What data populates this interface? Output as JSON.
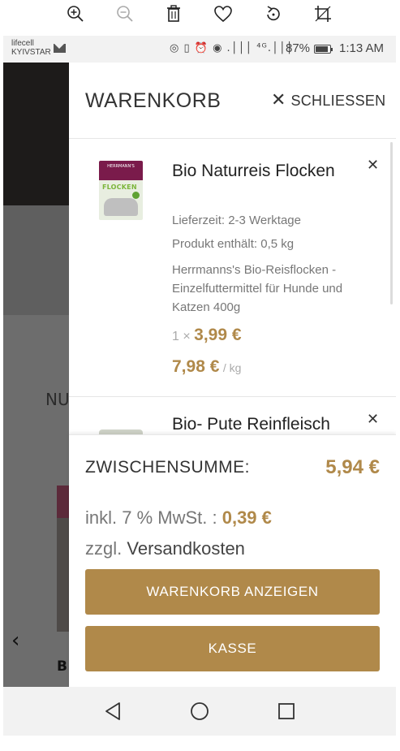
{
  "viewer_toolbar": {
    "icons": [
      "zoom-in-icon",
      "zoom-out-icon",
      "trash-icon",
      "heart-icon",
      "rotate-icon",
      "crop-icon"
    ]
  },
  "statusbar": {
    "carrier_line1": "lifecell",
    "carrier_line2": "KYIVSTAR",
    "icons_text": "◎ ▯ ⏰ ◉  .│││ ⁴ᴳ.│││",
    "battery_percent": "87%",
    "time": "1:13 AM"
  },
  "background_page": {
    "heading_fragment": "NU",
    "product_letter": "B",
    "arrow": "‹"
  },
  "cart": {
    "title": "WARENKORB",
    "close_label": "SCHLIESSEN",
    "items": [
      {
        "name": "Bio Naturreis Flocken",
        "thumbnail_brand": "HERRMANN'S",
        "thumbnail_word": "FLOCKEN",
        "delivery": "Lieferzeit: 2-3 Werktage",
        "content": "Produkt enthält: 0,5 kg",
        "description": "Herrmanns's Bio-Reisflocken - Einzelfuttermittel für Hunde und Katzen 400g",
        "quantity": "1 ×",
        "price": "3,99 €",
        "unit_price": "7,98 €",
        "unit_suffix": "/ kg"
      },
      {
        "name": "Bio- Pute Reinfleisch"
      }
    ],
    "subtotal_label": "ZWISCHENSUMME:",
    "subtotal_value": "5,94 €",
    "tax_label": "inkl. 7 % MwSt. :",
    "tax_value": "0,39 €",
    "shipping_prefix": "zzgl.",
    "shipping_link": "Versandkosten",
    "view_cart_button": "WARENKORB ANZEIGEN",
    "checkout_button": "KASSE",
    "accent_color": "#b0894a"
  },
  "navbar": {
    "icons": [
      "back-icon",
      "home-icon",
      "recents-icon"
    ]
  }
}
